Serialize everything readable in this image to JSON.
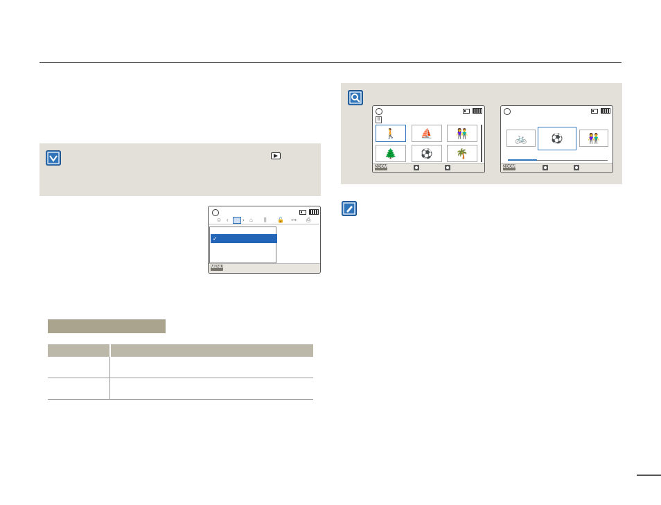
{
  "icons": {
    "tip_badge": "checkmark-tip-icon",
    "search_badge": "magnifier-icon",
    "note_badge": "pencil-note-icon",
    "play_mode": "playback-mode-icon",
    "thumb_subjects": [
      "🚶",
      "⛵",
      "👫",
      "🌲",
      "⚽",
      "🌴"
    ],
    "single_view_subjects": [
      "🚲",
      "⚽",
      "👫"
    ]
  },
  "colors": {
    "accent": "#2f74b9",
    "panel": "#e2e0d8",
    "table_title": "#aaa48f",
    "table_header": "#bcb8a9"
  },
  "lcd_menu": {
    "menu_key": "MENU",
    "tab_glyphs": [
      "☺",
      "‹",
      "⚙",
      "›",
      "⌂",
      "⫼",
      "🔓",
      "⊶",
      "⎙"
    ],
    "selected_mark": "✓"
  },
  "lcd_thumbs": {
    "zoom_key": "ZOOM",
    "folder_mark": "Ⅱ"
  },
  "lcd_single": {
    "zoom_key": "ZOOM"
  }
}
